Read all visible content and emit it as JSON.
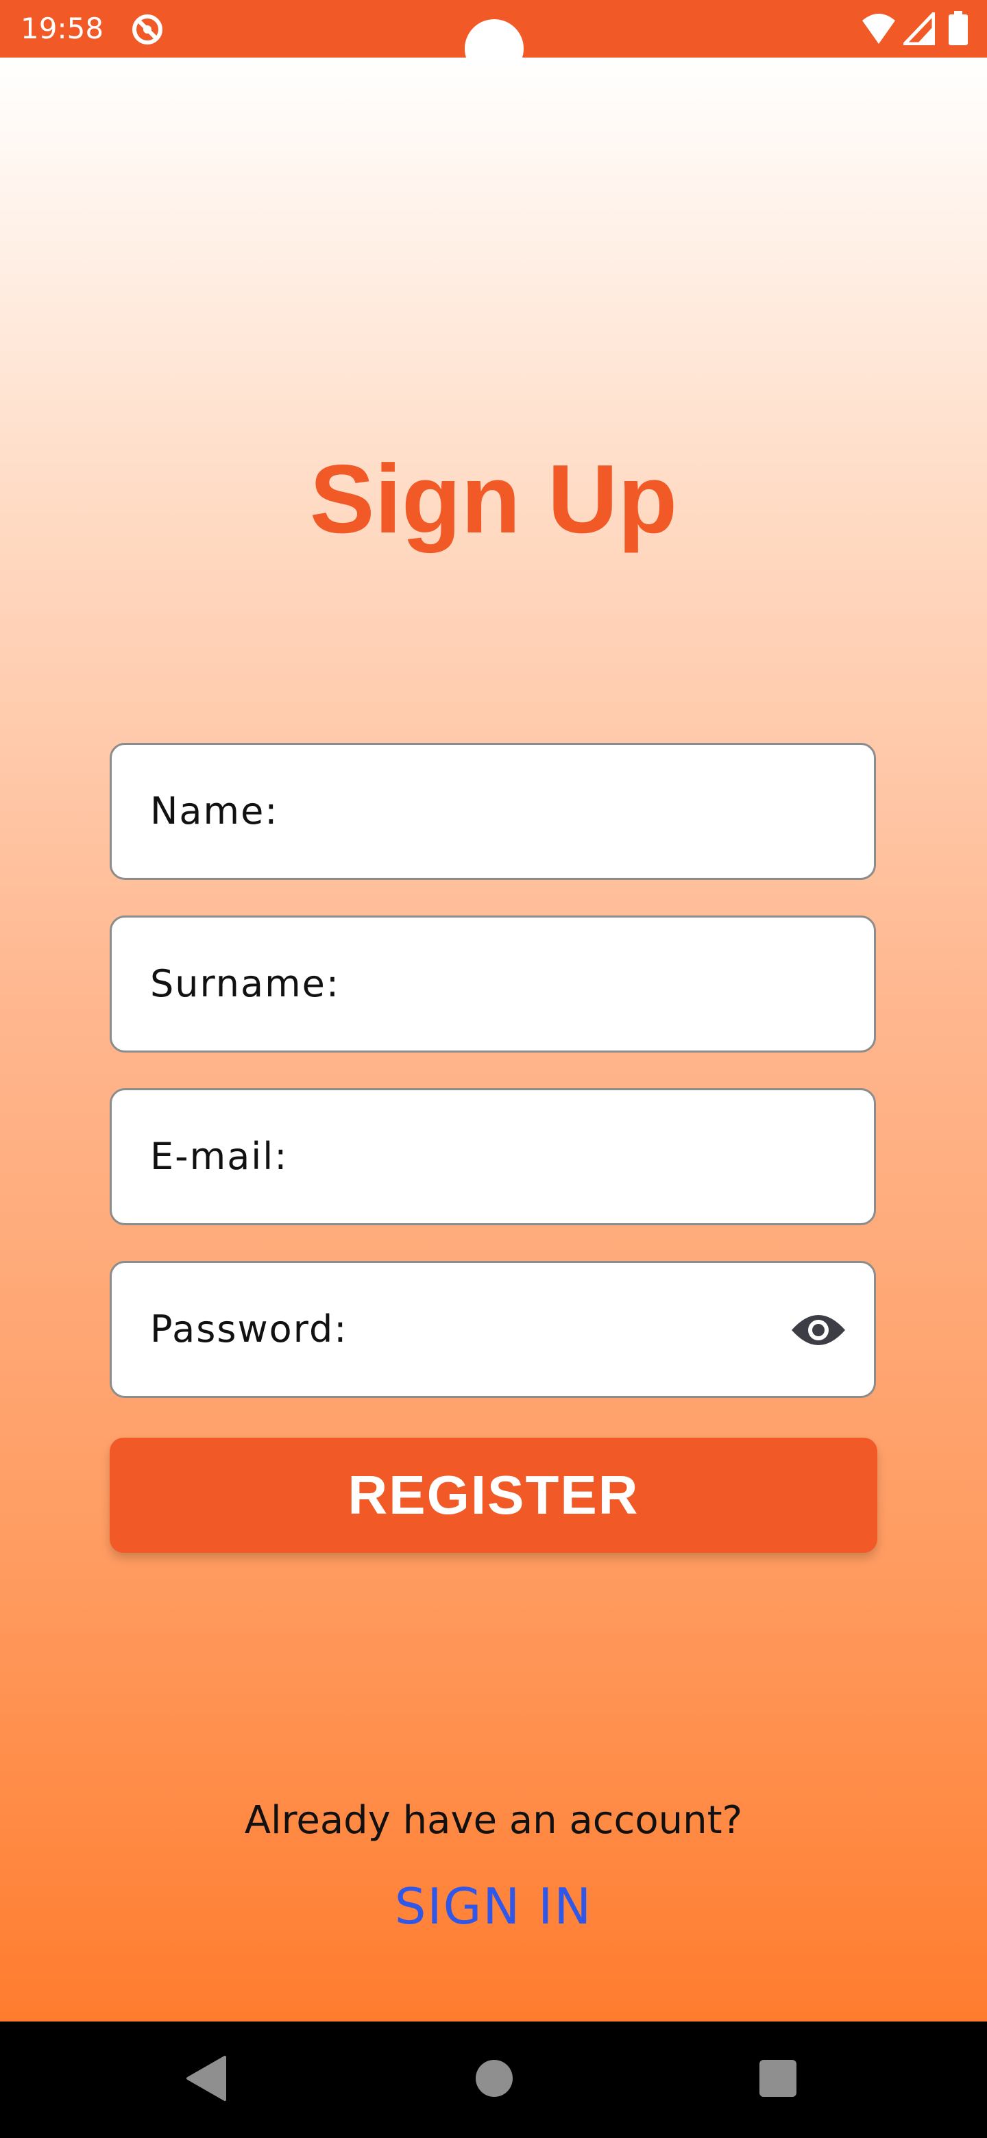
{
  "status_bar": {
    "time": "19:58",
    "icons": [
      "app-notification-icon",
      "wifi-icon",
      "signal-icon",
      "battery-icon"
    ]
  },
  "title": "Sign Up",
  "form": {
    "name_label": "Name:",
    "surname_label": "Surname:",
    "email_label": "E-mail:",
    "password_label": "Password:",
    "register_label": "REGISTER"
  },
  "footer": {
    "already_text": "Already have an account?",
    "sign_in_label": "SIGN IN"
  },
  "colors": {
    "accent": "#f15a27",
    "link": "#2f57e8",
    "background_top": "#ffffff",
    "background_bottom": "#ff7c2e"
  },
  "nav_bar": {
    "icons": [
      "back-icon",
      "home-icon",
      "recents-icon"
    ]
  }
}
